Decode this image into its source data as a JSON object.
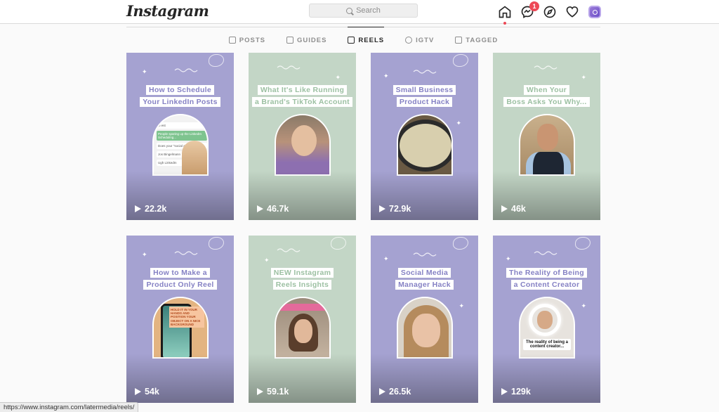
{
  "app": {
    "logo": "Instagram"
  },
  "search": {
    "placeholder": "Search"
  },
  "nav": {
    "messages_badge": "1"
  },
  "tabs": [
    {
      "label": "POSTS",
      "icon": "grid-icon"
    },
    {
      "label": "GUIDES",
      "icon": "guides-icon"
    },
    {
      "label": "REELS",
      "icon": "reels-icon",
      "active": true
    },
    {
      "label": "IGTV",
      "icon": "igtv-icon"
    },
    {
      "label": "TAGGED",
      "icon": "tagged-icon"
    }
  ],
  "reels": [
    {
      "title1": "How to Schedule",
      "title2": "Your LinkedIn Posts",
      "views": "22.2k",
      "theme": "purple",
      "mock": {
        "line1": "jo est",
        "pill": "People sparing up the LinkedIn Scheduling...",
        "line2": "Does your \"social ads\" ...",
        "name": "Jos Bingelmann",
        "line3": "Ugh LinkedIn"
      }
    },
    {
      "title1": "What It's Like Running",
      "title2": "a Brand's TikTok Account",
      "views": "46.7k",
      "theme": "green"
    },
    {
      "title1": "Small Business",
      "title2": "Product Hack",
      "views": "72.9k",
      "theme": "purple"
    },
    {
      "title1": "When Your",
      "title2": "Boss Asks You Why...",
      "views": "46k",
      "theme": "green"
    },
    {
      "title1": "How to Make a",
      "title2": "Product Only Reel",
      "views": "54k",
      "theme": "purple",
      "note": "HOLD IT IN YOUR HANDS AND POSITION YOUR OBJECT ON A NICE BACKGROUND"
    },
    {
      "title1": "NEW Instagram",
      "title2": "Reels Insights",
      "views": "59.1k",
      "theme": "green"
    },
    {
      "title1": "Social Media",
      "title2": "Manager Hack",
      "views": "26.5k",
      "theme": "purple"
    },
    {
      "title1": "The Reality of Being",
      "title2": "a Content Creator",
      "views": "129k",
      "theme": "purple",
      "caption": "The reality of being a content creator..."
    }
  ],
  "status": {
    "url": "https://www.instagram.com/latermedia/reels/"
  },
  "colors": {
    "purple_tile": "#a5a2d1",
    "green_tile": "#c3d6c6",
    "badge": "#ed4956"
  }
}
